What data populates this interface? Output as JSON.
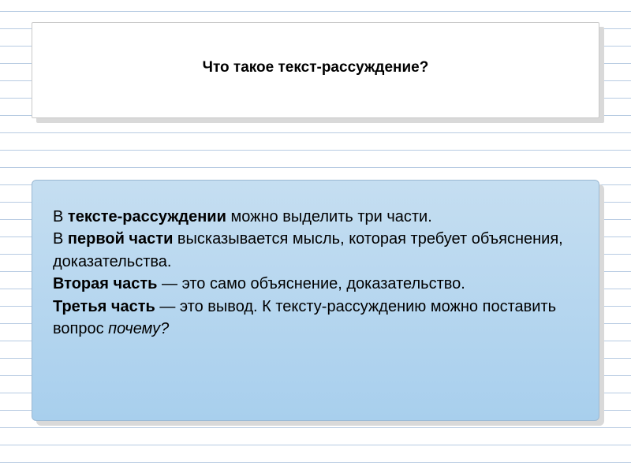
{
  "title": "Что такое текст-рассуждение?",
  "body": {
    "p1_lead": "тексте-рассуждении",
    "p1_tail": " можно выделить три части.",
    "p2_lead": "первой части",
    "p2_tail": " высказывается мысль, которая требует объяснения, доказательства.",
    "p3_lead": "Вторая часть",
    "p3_tail": " — это само объяснение, доказательство.",
    "p4_lead": "Третья часть",
    "p4_tail": " — это вывод. К тексту-рассуждению можно поставить вопрос ",
    "p4_em": "почему?"
  },
  "line_positions": [
    14,
    36,
    58,
    80,
    102,
    124,
    146,
    168,
    190,
    212,
    234,
    256,
    278,
    300,
    322,
    344,
    366,
    388,
    410,
    432,
    454,
    476,
    498,
    520,
    542,
    564,
    586
  ]
}
